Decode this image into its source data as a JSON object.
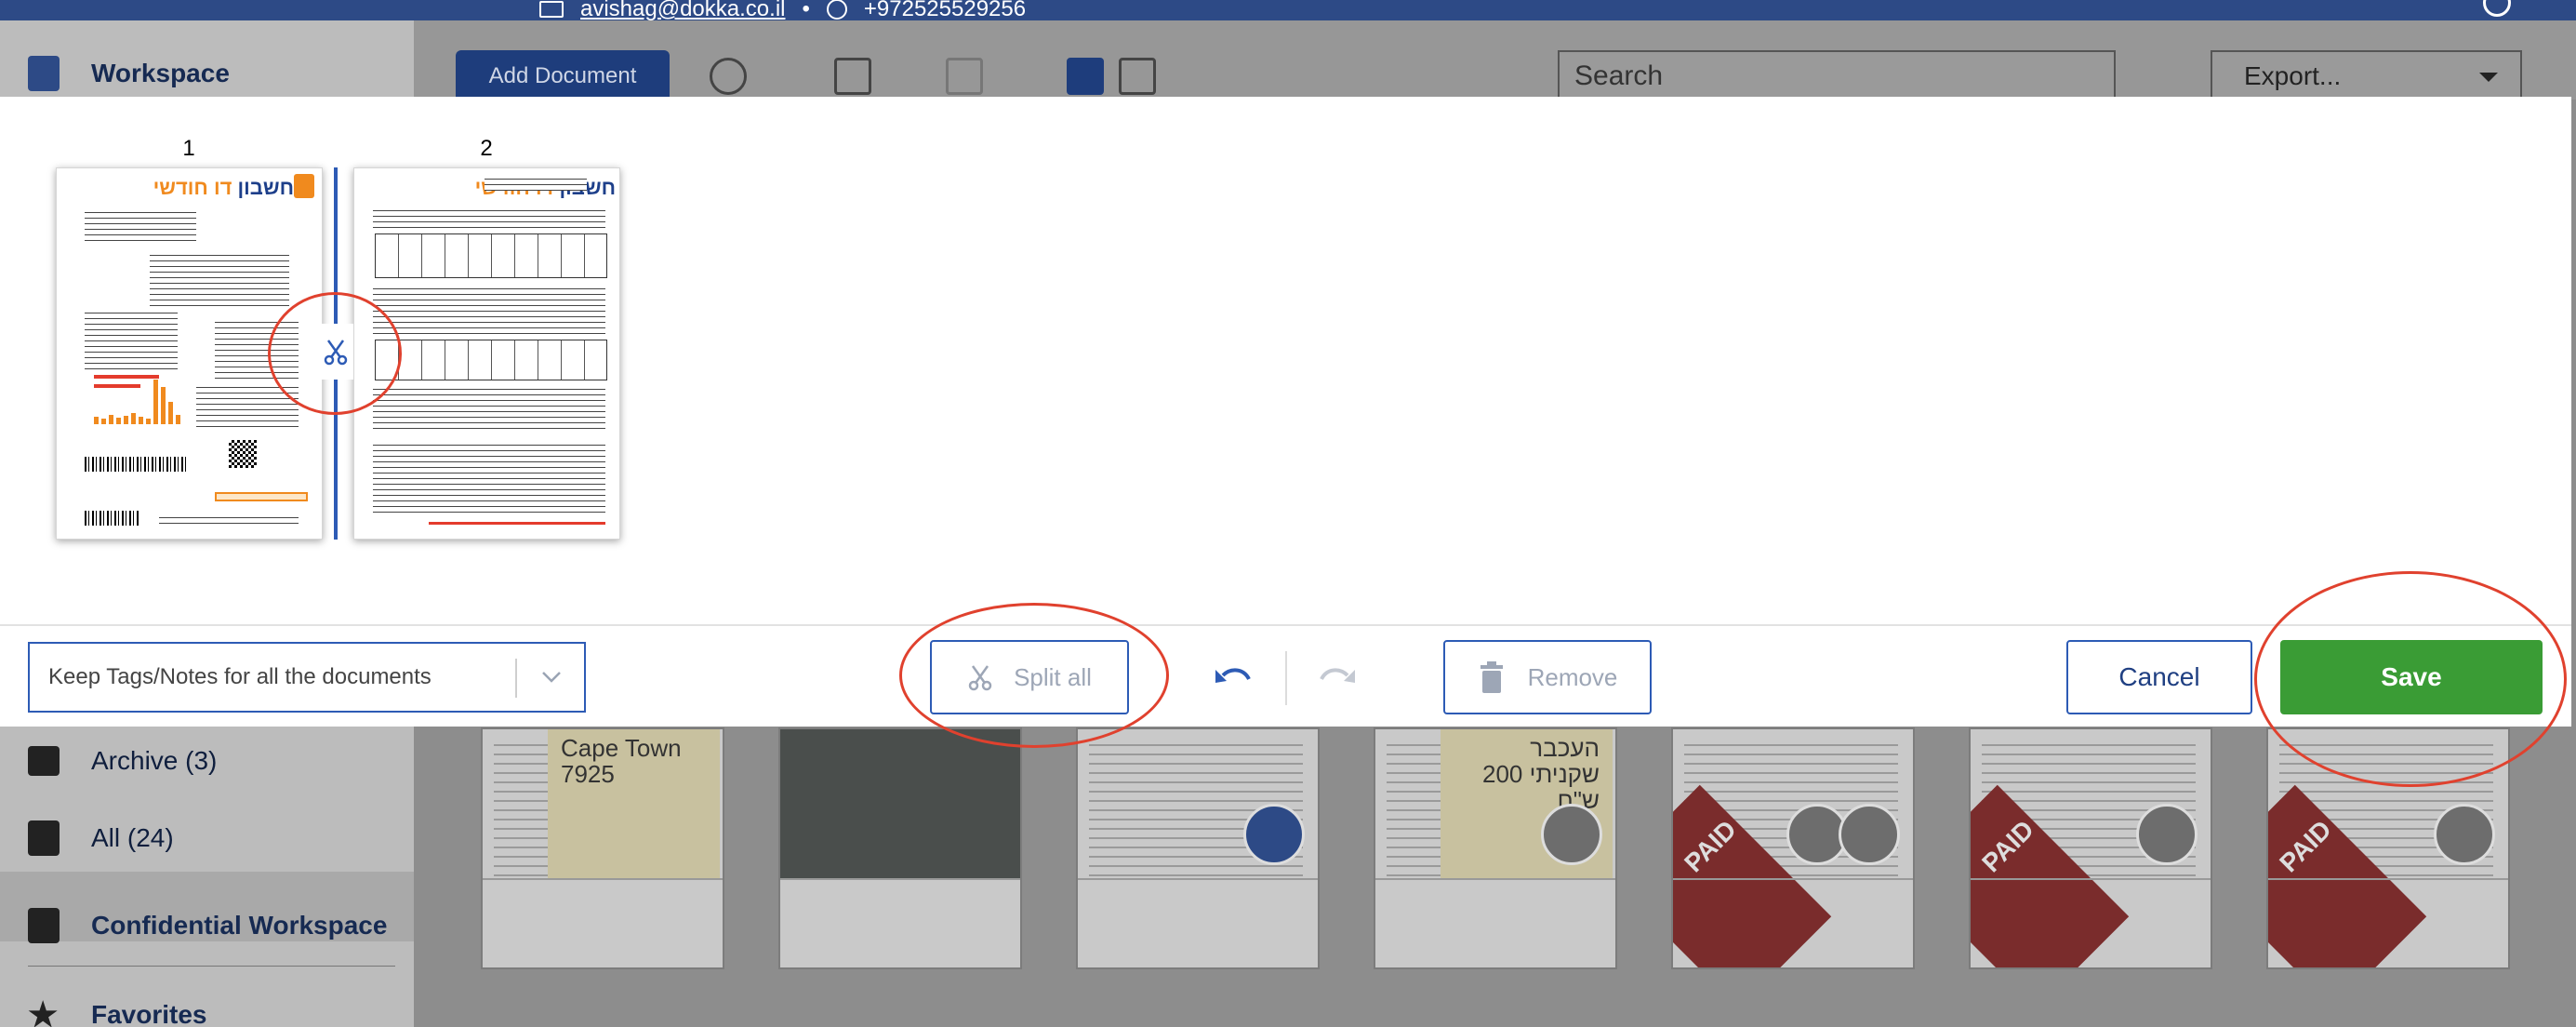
{
  "header": {
    "email": "avishag@dokka.co.il",
    "dot": "•",
    "phone": "+972525529256"
  },
  "sidebar": {
    "workspace": "Workspace",
    "archive": "Archive (3)",
    "all": "All (24)",
    "confidential": "Confidential Workspace",
    "favorites": "Favorites"
  },
  "toolbar": {
    "add_document": "Add Document",
    "search_placeholder": "Search",
    "export": "Export..."
  },
  "background_cards": {
    "card1_note": "Cape Town 7925",
    "card4_note": "העכבר שקניתי 200 ש\"ח",
    "paid_label": "PAID"
  },
  "split_modal": {
    "pages": [
      {
        "number": "1",
        "header_blue": "חשבון",
        "header_orange": "דו חודשי"
      },
      {
        "number": "2",
        "header_blue": "חשבון",
        "header_orange": "דו חודשי"
      }
    ],
    "keep_tags_select": "Keep Tags/Notes for all the documents",
    "split_all": "Split all",
    "remove": "Remove",
    "cancel": "Cancel",
    "save": "Save"
  },
  "colors": {
    "primary_blue": "#2d5bb5",
    "save_green": "#3a9c35",
    "annotation_red": "#e0412e",
    "brand_orange": "#f08a1e"
  }
}
